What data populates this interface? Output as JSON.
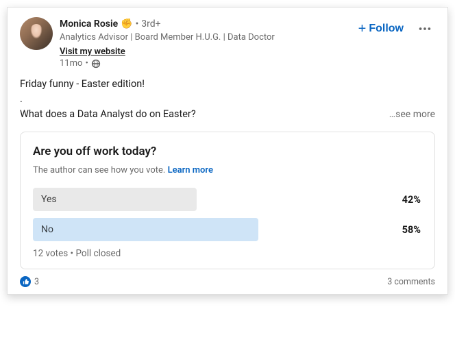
{
  "author": {
    "name": "Monica Rosie",
    "emoji": "✊",
    "degree_sep": "•",
    "degree": "3rd+",
    "headline": "Analytics Advisor | Board Member H.U.G. | Data Doctor",
    "website_label": "Visit my website",
    "time": "11mo",
    "time_sep": "•"
  },
  "actions": {
    "follow_label": "Follow"
  },
  "post": {
    "line1": "Friday funny - Easter edition!",
    "line2": ".",
    "line3": "What does a Data Analyst do on Easter?",
    "see_more": "…see more"
  },
  "poll": {
    "question": "Are you off work today?",
    "subtext": "The author can see how you vote.",
    "learn_more": "Learn more",
    "options": [
      {
        "label": "Yes",
        "pct_label": "42%",
        "pct": 42,
        "style": "gray"
      },
      {
        "label": "No",
        "pct_label": "58%",
        "pct": 58,
        "style": "blue"
      }
    ],
    "footer": "12 votes • Poll closed"
  },
  "social": {
    "reactions": "3",
    "comments": "3 comments"
  }
}
